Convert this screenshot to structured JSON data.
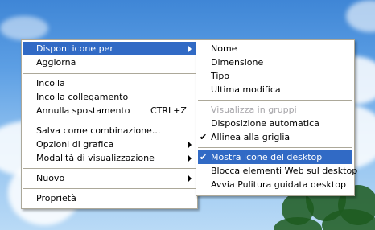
{
  "context_menu": {
    "items": [
      {
        "label": "Disponi icone per",
        "submenu": true,
        "highlighted": true
      },
      {
        "label": "Aggiorna"
      },
      {
        "label": "Incolla"
      },
      {
        "label": "Incolla collegamento"
      },
      {
        "label": "Annulla spostamento",
        "shortcut": "CTRL+Z"
      },
      {
        "label": "Salva come combinazione..."
      },
      {
        "label": "Opzioni di grafica",
        "submenu": true
      },
      {
        "label": "Modalità di visualizzazione",
        "submenu": true
      },
      {
        "label": "Nuovo",
        "submenu": true
      },
      {
        "label": "Proprietà"
      }
    ]
  },
  "submenu": {
    "items": [
      {
        "label": "Nome"
      },
      {
        "label": "Dimensione"
      },
      {
        "label": "Tipo"
      },
      {
        "label": "Ultima modifica"
      },
      {
        "label": "Visualizza in gruppi",
        "disabled": true
      },
      {
        "label": "Disposizione automatica"
      },
      {
        "label": "Allinea alla griglia",
        "checked": true
      },
      {
        "label": "Mostra icone del desktop",
        "checked": true,
        "highlighted": true
      },
      {
        "label": "Blocca elementi Web sul desktop"
      },
      {
        "label": "Avvia Pulitura guidata desktop"
      }
    ],
    "check_glyph": "✔"
  },
  "colors": {
    "highlight": "#316ac5",
    "disabled_text": "#a7a6aa",
    "separator": "#aca899"
  }
}
